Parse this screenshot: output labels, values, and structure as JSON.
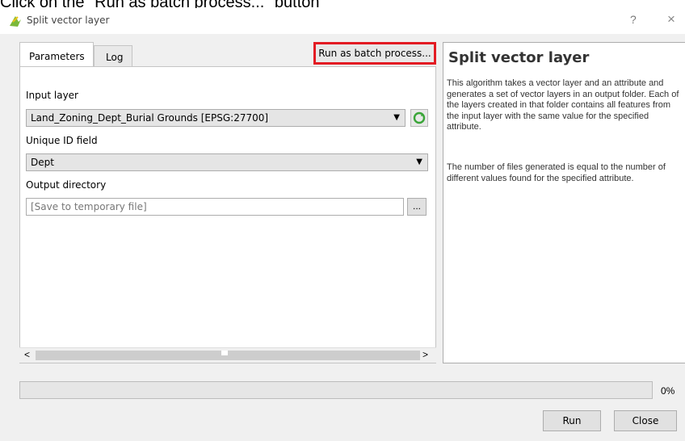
{
  "instruction": "Click on the \"Run as batch process...\" button",
  "window": {
    "title": "Split vector layer",
    "help_glyph": "?",
    "close_glyph": "×"
  },
  "tabs": [
    {
      "label": "Parameters"
    },
    {
      "label": "Log"
    }
  ],
  "batch_button_label": "Run as batch process...",
  "parameters": {
    "input_layer": {
      "label": "Input layer",
      "value": "Land_Zoning_Dept_Burial Grounds [EPSG:27700]"
    },
    "unique_id": {
      "label": "Unique ID field",
      "value": "Dept"
    },
    "output_dir": {
      "label": "Output directory",
      "placeholder": "[Save to temporary file]",
      "browse_label": "..."
    }
  },
  "scrollbar": {
    "left_arrow": "<",
    "right_arrow": ">"
  },
  "help": {
    "title": "Split vector layer",
    "paragraph1": "This algorithm takes a vector layer and an attribute and generates a set of vector layers in an output folder. Each of the layers created in that folder contains all features from the input layer with the same value for the specified attribute.",
    "paragraph2": "The number of files generated is equal to the number of different values found for the specified attribute."
  },
  "progress": {
    "value": 0,
    "label": "0%"
  },
  "buttons": {
    "run": "Run",
    "close": "Close"
  },
  "colors": {
    "highlight": "#e31b23",
    "accent_green": "#3aa538"
  },
  "icons": {
    "window": "qgis-icon",
    "iterate": "iterate-icon"
  }
}
